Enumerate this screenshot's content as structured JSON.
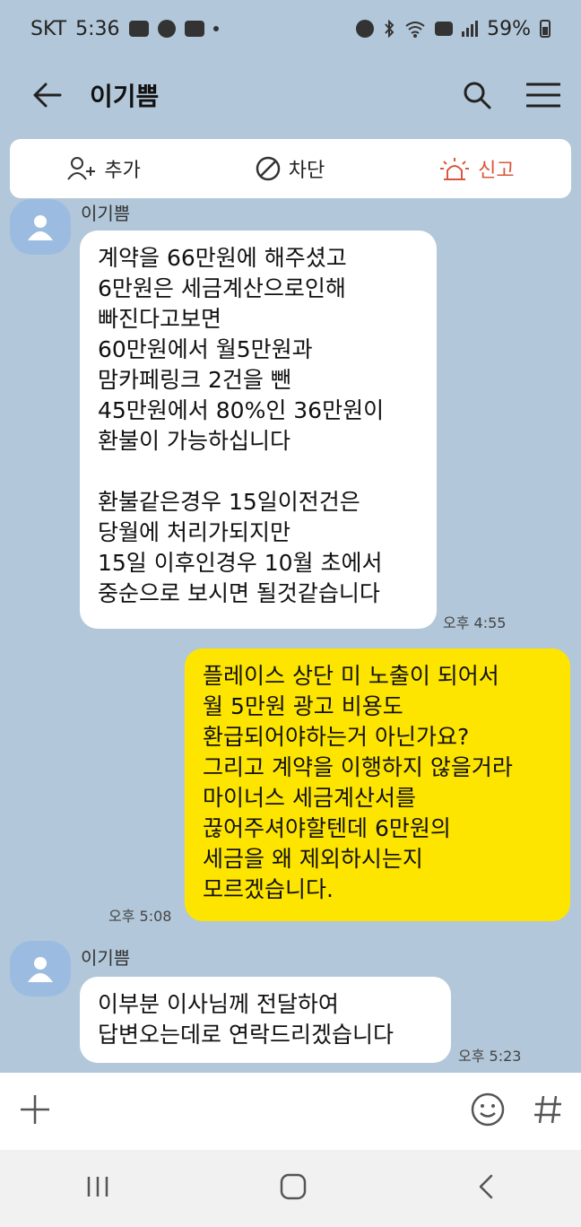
{
  "status": {
    "carrier": "SKT",
    "time": "5:36",
    "battery": "59%"
  },
  "header": {
    "title": "이기쁨"
  },
  "actions": {
    "add": "추가",
    "block": "차단",
    "report": "신고"
  },
  "messages": [
    {
      "sender": "이기쁨",
      "text": "계약을 66만원에 해주셨고\n6만원은 세금계산으로인해\n빠진다고보면\n60만원에서 월5만원과\n맘카페링크 2건을 뺀\n45만원에서 80%인 36만원이\n환불이 가능하십니다\n\n환불같은경우 15일이전건은\n당월에 처리가되지만\n15일 이후인경우 10월 초에서\n중순으로 보시면 될것같습니다",
      "time": "오후 4:55"
    },
    {
      "text": "플레이스 상단 미 노출이 되어서\n월 5만원 광고 비용도\n환급되어야하는거 아닌가요?\n그리고 계약을 이행하지 않을거라\n마이너스 세금계산서를\n끊어주셔야할텐데 6만원의\n세금을 왜 제외하시는지\n모르겠습니다.",
      "time": "오후 5:08"
    },
    {
      "sender": "이기쁨",
      "text": "이부분 이사님께 전달하여\n답변오는데로 연락드리겠습니다",
      "time": "오후 5:23"
    }
  ],
  "colors": {
    "background": "#b2c7d9",
    "my_bubble": "#fee500",
    "report": "#d9573b"
  }
}
